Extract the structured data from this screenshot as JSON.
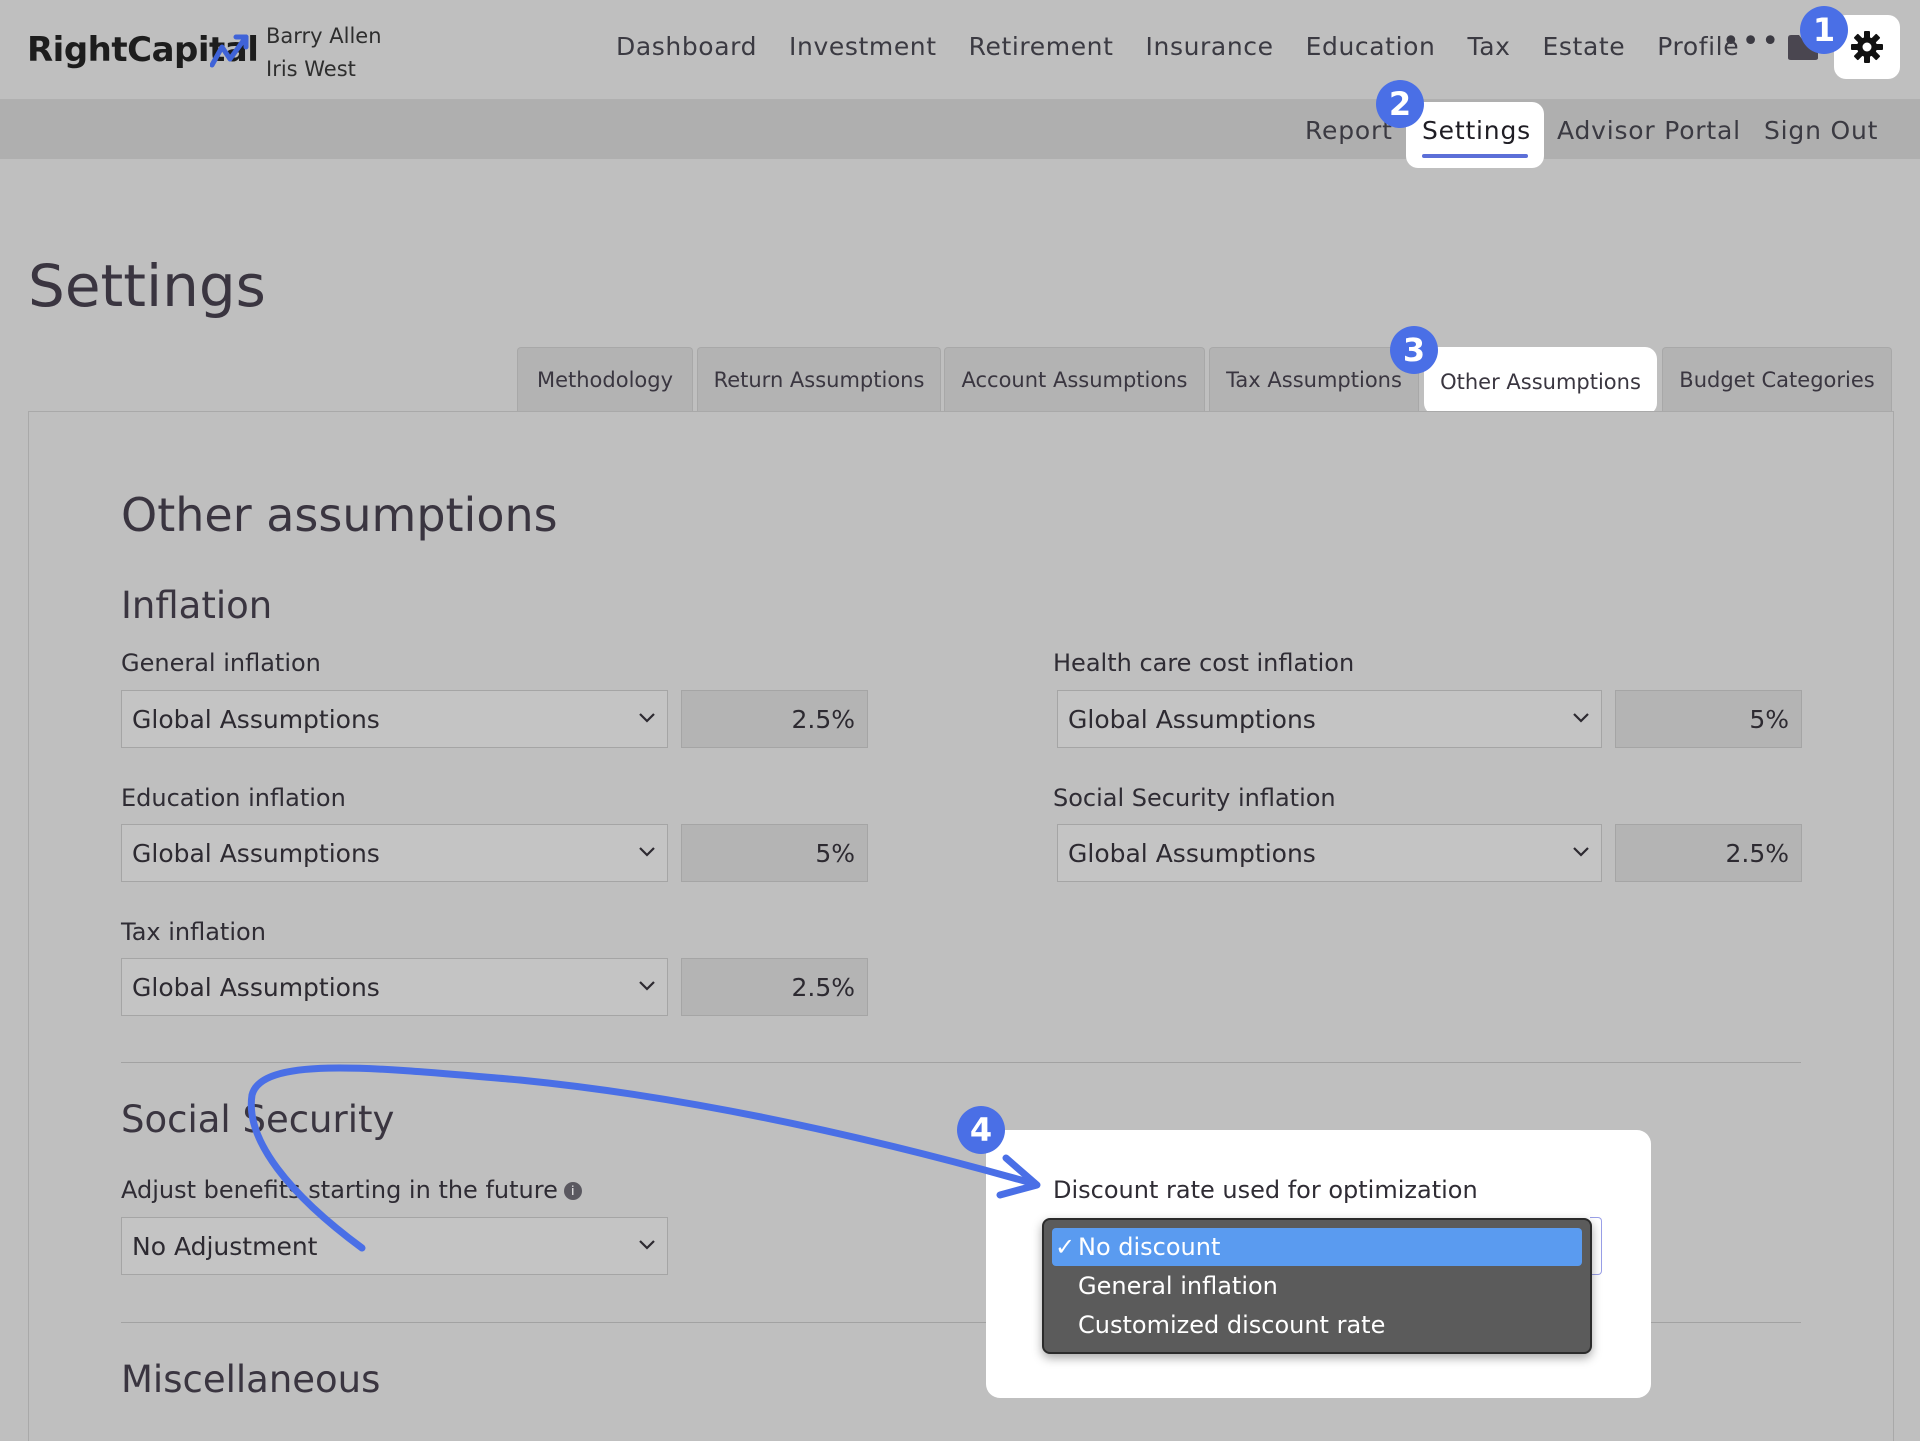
{
  "app": {
    "logo": "RightCapital",
    "clients": [
      "Barry Allen",
      "Iris West"
    ]
  },
  "main_nav": {
    "items": [
      "Dashboard",
      "Investment",
      "Retirement",
      "Insurance",
      "Education",
      "Tax",
      "Estate",
      "Profile"
    ],
    "more": "•••"
  },
  "sub_nav": {
    "report": "Report",
    "settings": "Settings",
    "advisor_portal": "Advisor Portal",
    "sign_out": "Sign Out"
  },
  "page": {
    "title": "Settings"
  },
  "tabs": [
    "Methodology",
    "Return Assumptions",
    "Account Assumptions",
    "Tax Assumptions",
    "Other Assumptions",
    "Budget Categories"
  ],
  "other_assumptions": {
    "title": "Other assumptions",
    "inflation": {
      "title": "Inflation",
      "general": {
        "label": "General inflation",
        "select": "Global Assumptions",
        "value": "2.5%"
      },
      "health_care": {
        "label": "Health care cost inflation",
        "select": "Global Assumptions",
        "value": "5%"
      },
      "education": {
        "label": "Education inflation",
        "select": "Global Assumptions",
        "value": "5%"
      },
      "social_security": {
        "label": "Social Security inflation",
        "select": "Global Assumptions",
        "value": "2.5%"
      },
      "tax": {
        "label": "Tax inflation",
        "select": "Global Assumptions",
        "value": "2.5%"
      }
    },
    "social_security": {
      "title": "Social Security",
      "adjust_label": "Adjust benefits starting in the future",
      "adjust_value": "No Adjustment",
      "discount_label": "Discount rate used for optimization",
      "discount_options": [
        "No discount",
        "General inflation",
        "Customized discount rate"
      ],
      "discount_selected": "No discount",
      "check": "✓"
    },
    "miscellaneous": {
      "title": "Miscellaneous"
    }
  },
  "badges": [
    "1",
    "2",
    "3",
    "4"
  ],
  "colors": {
    "accent": "#4a6fe6",
    "underline": "#5c6fd8",
    "dropdown_selected": "#5a9bf0"
  },
  "icons": [
    "folder-icon",
    "gear-icon",
    "chevron-down-icon",
    "info-icon",
    "arrow-annotation"
  ]
}
